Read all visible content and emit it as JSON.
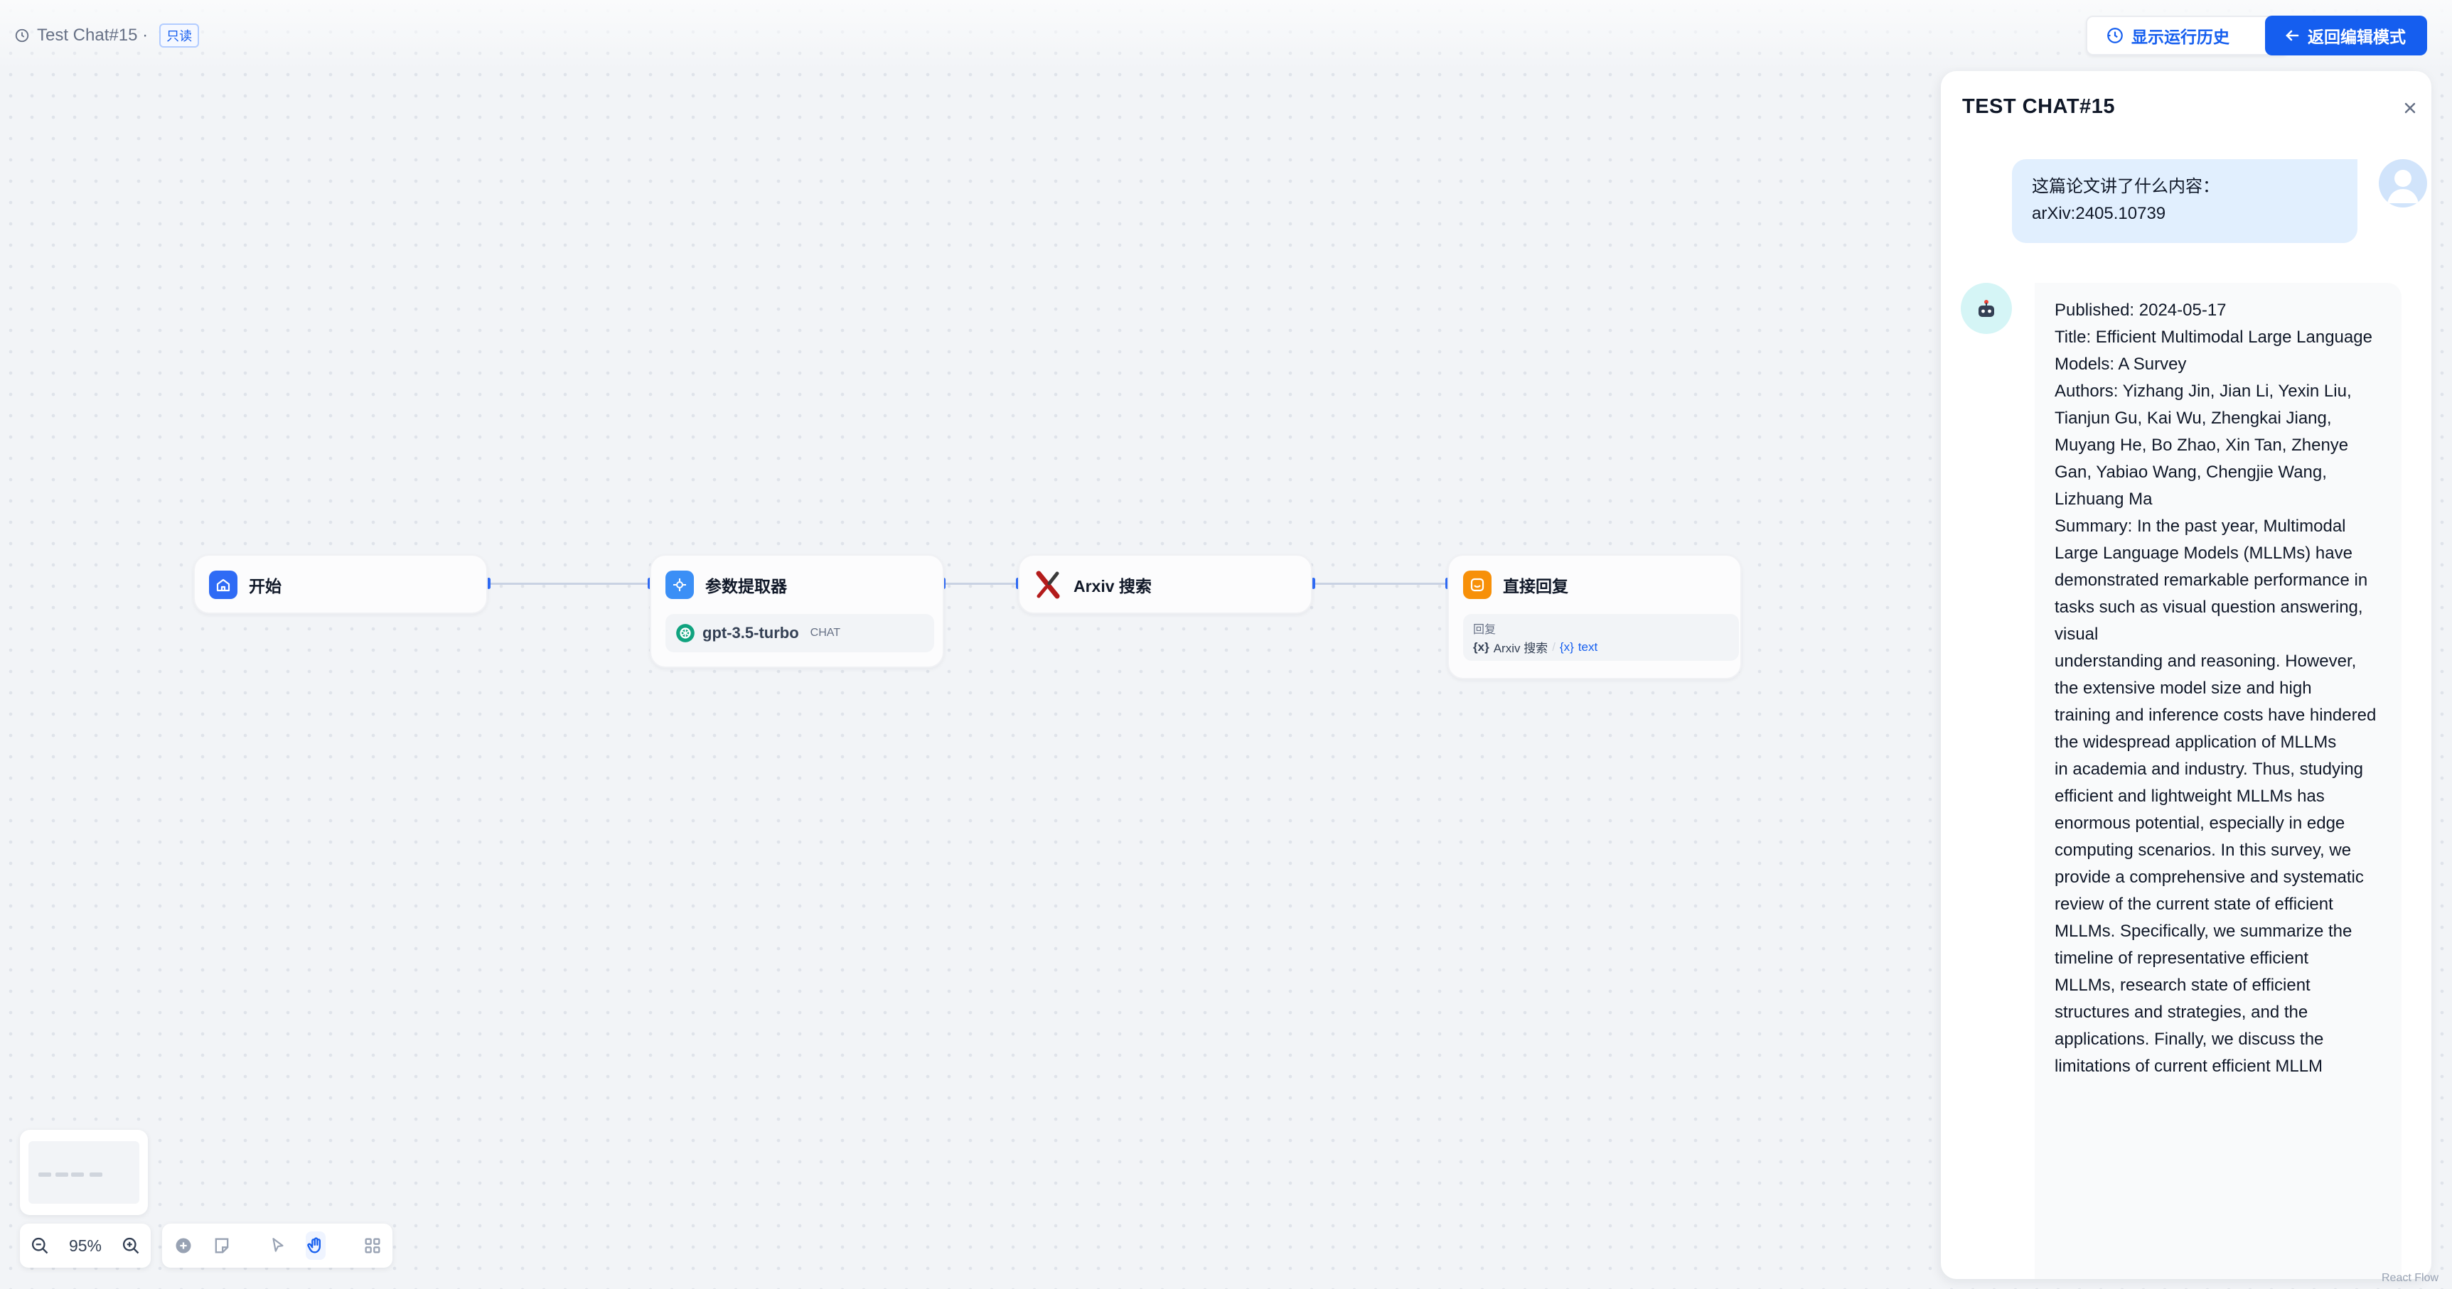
{
  "header": {
    "app_title": "Test Chat#15 ·",
    "readonly_badge": "只读",
    "history_button": "显示运行历史",
    "back_button": "返回编辑模式"
  },
  "nodes": {
    "start": {
      "label": "开始"
    },
    "extractor": {
      "label": "参数提取器",
      "model": "gpt-3.5-turbo",
      "model_tag": "CHAT"
    },
    "arxiv": {
      "label": "Arxiv 搜索"
    },
    "answer": {
      "label": "直接回复",
      "reply_label": "回复",
      "var_node": "Arxiv 搜索",
      "var_sep": "/",
      "var_name": "text"
    }
  },
  "zoom": {
    "level": "95%"
  },
  "chat": {
    "title": "TEST CHAT#15",
    "user_message": "这篇论文讲了什么内容：\narXiv:2405.10739",
    "bot_message": "Published: 2024-05-17\nTitle: Efficient Multimodal Large Language Models: A Survey\nAuthors: Yizhang Jin, Jian Li, Yexin Liu, Tianjun Gu, Kai Wu, Zhengkai Jiang, Muyang He, Bo Zhao, Xin Tan, Zhenye Gan, Yabiao Wang, Chengjie Wang, Lizhuang Ma\nSummary: In the past year, Multimodal Large Language Models (MLLMs) have demonstrated remarkable performance in tasks such as visual question answering, visual\nunderstanding and reasoning. However, the extensive model size and high\ntraining and inference costs have hindered the widespread application of MLLMs\nin academia and industry. Thus, studying efficient and lightweight MLLMs has\nenormous potential, especially in edge computing scenarios. In this survey, we\nprovide a comprehensive and systematic review of the current state of efficient\nMLLMs. Specifically, we summarize the timeline of representative efficient\nMLLMs, research state of efficient structures and strategies, and the applications. Finally, we discuss the limitations of current efficient MLLM"
  },
  "footer": {
    "attribution": "React Flow"
  },
  "colors": {
    "accent": "#155eef",
    "start_icon": "#2f6bf5",
    "extractor_icon": "#3b8ff6",
    "answer_icon": "#f79009",
    "arxiv_icon": "#b31b1b",
    "model_icon": "#10a37f"
  }
}
